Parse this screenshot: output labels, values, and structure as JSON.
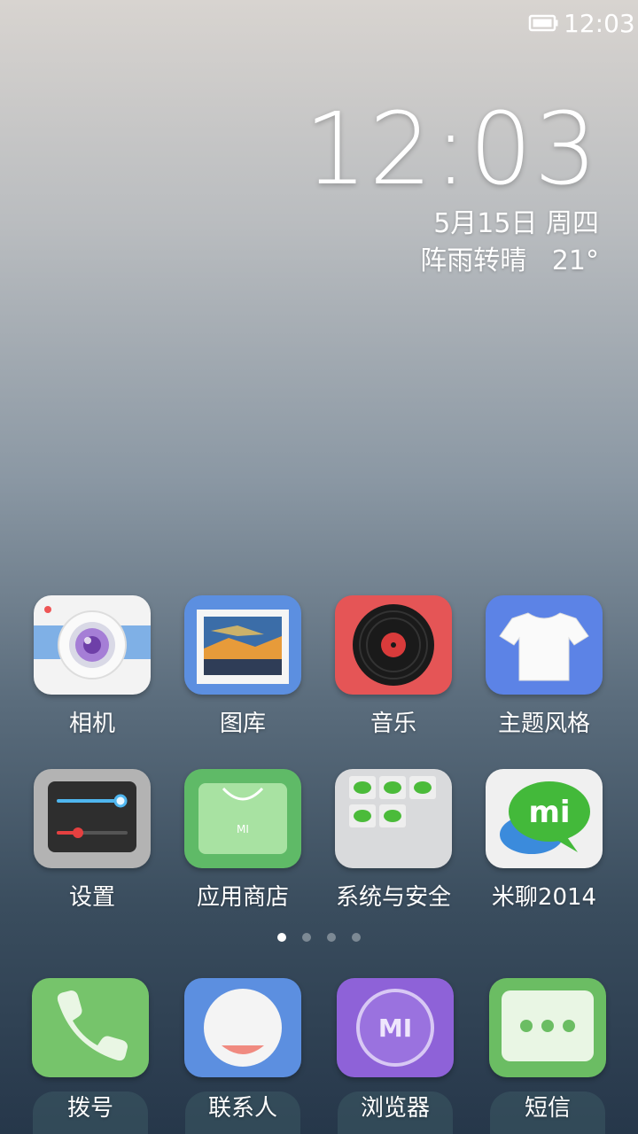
{
  "status_bar": {
    "time": "12:03",
    "battery_icon": "battery-full-icon"
  },
  "clock": {
    "time": "12:03",
    "date": "5月15日 周四",
    "weather": "阵雨转晴   21°"
  },
  "apps": [
    {
      "label": "相机",
      "icon": "camera-icon"
    },
    {
      "label": "图库",
      "icon": "gallery-icon"
    },
    {
      "label": "音乐",
      "icon": "music-icon"
    },
    {
      "label": "主题风格",
      "icon": "theme-icon"
    },
    {
      "label": "设置",
      "icon": "settings-icon"
    },
    {
      "label": "应用商店",
      "icon": "app-store-icon"
    },
    {
      "label": "系统与安全",
      "icon": "folder-icon"
    },
    {
      "label": "米聊2014",
      "icon": "miliao-icon"
    }
  ],
  "page_indicator": {
    "total": 4,
    "active": 1
  },
  "dock": [
    {
      "label": "拨号",
      "icon": "phone-icon"
    },
    {
      "label": "联系人",
      "icon": "contacts-icon"
    },
    {
      "label": "浏览器",
      "icon": "browser-icon"
    },
    {
      "label": "短信",
      "icon": "messages-icon"
    }
  ],
  "colors": {
    "camera": "#f4f4f4",
    "gallery": "#5c8fe0",
    "music": "#e55556",
    "theme": "#5c83e6",
    "settings": "#b3b3b3",
    "store": "#5fba67",
    "folder": "#d9dadc",
    "miliao": "#f0f0f0",
    "phone": "#76c46b",
    "contacts": "#5c8fe0",
    "browser": "#8e62d8",
    "messages": "#6bbd63"
  }
}
